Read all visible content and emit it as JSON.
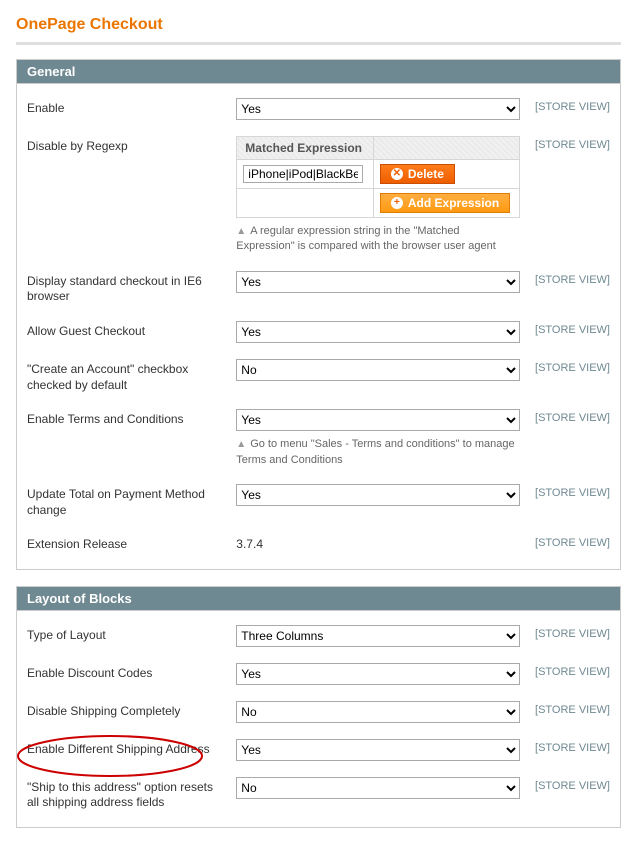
{
  "page": {
    "title": "OnePage Checkout"
  },
  "scope_label": "[STORE VIEW]",
  "sections": {
    "general": {
      "title": "General",
      "enable": {
        "label": "Enable",
        "value": "Yes"
      },
      "disable_regexp": {
        "label": "Disable by Regexp",
        "col_header": "Matched Expression",
        "input_value": "iPhone|iPod|BlackBer",
        "delete_label": "Delete",
        "add_label": "Add Expression",
        "hint": "A regular expression string in the \"Matched Expression\" is compared with the browser user agent"
      },
      "ie6": {
        "label": "Display standard checkout in IE6 browser",
        "value": "Yes"
      },
      "guest": {
        "label": "Allow Guest Checkout",
        "value": "Yes"
      },
      "create_acct": {
        "label": "\"Create an Account\" checkbox checked by default",
        "value": "No"
      },
      "terms": {
        "label": "Enable Terms and Conditions",
        "value": "Yes",
        "hint": "Go to menu \"Sales - Terms and conditions\" to manage Terms and Conditions"
      },
      "update_total": {
        "label": "Update Total on Payment Method change",
        "value": "Yes"
      },
      "release": {
        "label": "Extension Release",
        "value": "3.7.4"
      }
    },
    "layout": {
      "title": "Layout of Blocks",
      "type": {
        "label": "Type of Layout",
        "value": "Three Columns"
      },
      "discount": {
        "label": "Enable Discount Codes",
        "value": "Yes"
      },
      "disable_ship": {
        "label": "Disable Shipping Completely",
        "value": "No"
      },
      "diff_ship": {
        "label": "Enable Different Shipping Address",
        "value": "Yes"
      },
      "ship_reset": {
        "label": "\"Ship to this address\" option resets all shipping address fields",
        "value": "No"
      }
    }
  }
}
